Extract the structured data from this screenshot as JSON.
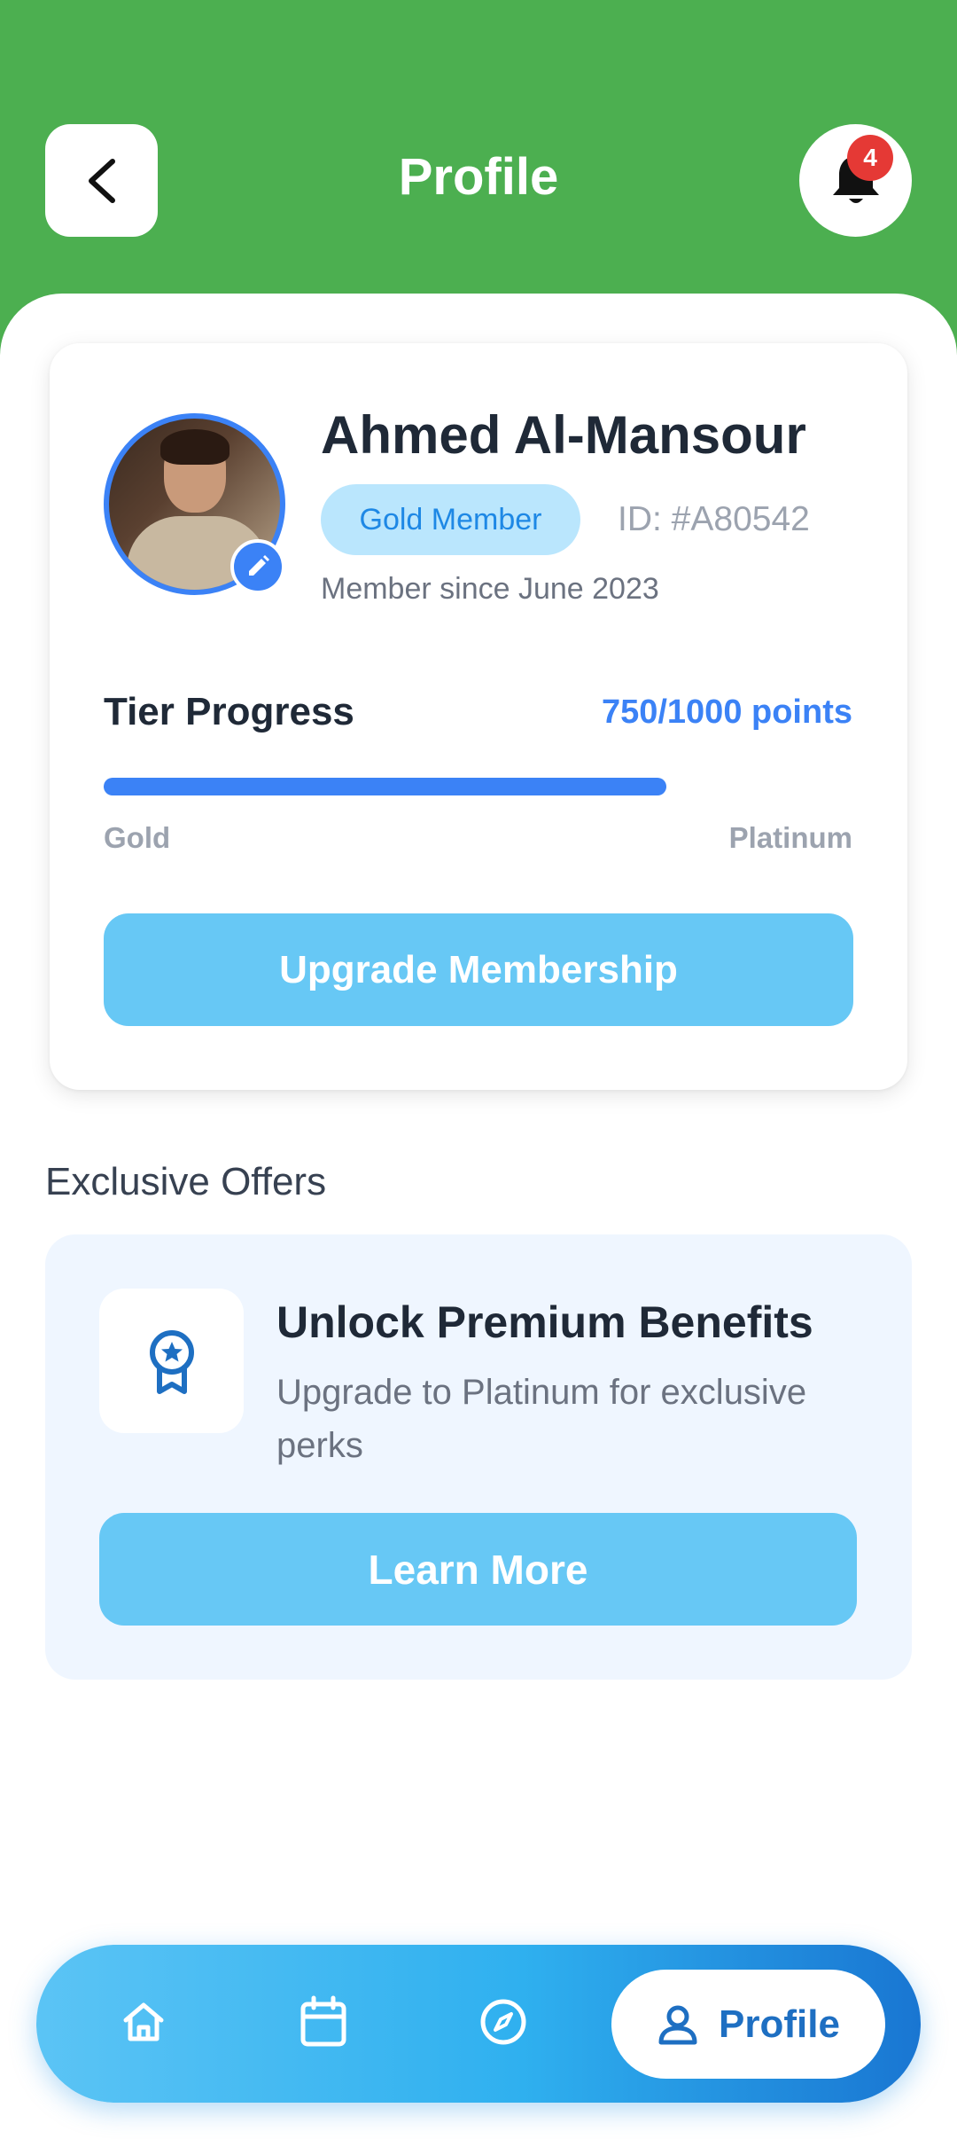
{
  "header": {
    "title": "Profile",
    "notification_count": "4",
    "back_icon": "chevron-left-icon",
    "bell_icon": "bell-icon"
  },
  "profile": {
    "name": "Ahmed Al-Mansour",
    "tier_badge": "Gold Member",
    "member_id": "ID: #A80542",
    "member_since": "Member since June 2023"
  },
  "tier": {
    "label": "Tier Progress",
    "points_text": "750/1000 points",
    "progress_fraction": 0.75,
    "start_label": "Gold",
    "end_label": "Platinum"
  },
  "actions": {
    "upgrade_label": "Upgrade Membership"
  },
  "offers": {
    "section_title": "Exclusive Offers",
    "card_title": "Unlock Premium Benefits",
    "card_description": "Upgrade to Platinum for exclusive perks",
    "card_button": "Learn More",
    "card_icon": "award-ribbon-icon"
  },
  "nav": {
    "items": [
      {
        "icon": "home-icon"
      },
      {
        "icon": "calendar-icon"
      },
      {
        "icon": "compass-icon"
      }
    ],
    "active": {
      "icon": "user-icon",
      "label": "Profile"
    }
  },
  "colors": {
    "header_green": "#4caf50",
    "accent_blue": "#3b82f6",
    "button_light_blue": "#67c8f5",
    "badge_red": "#e53935"
  }
}
